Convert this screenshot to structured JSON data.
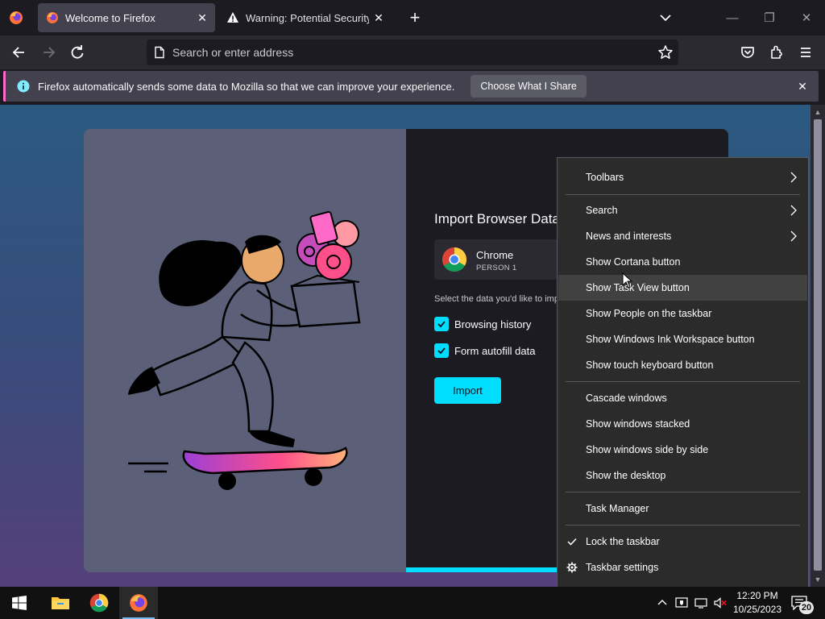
{
  "tabs": [
    {
      "label": "Welcome to Firefox",
      "active": true,
      "icon": "firefox-icon"
    },
    {
      "label": "Warning: Potential Security Risk Ahead",
      "active": false,
      "icon": "warning-icon"
    }
  ],
  "urlbar": {
    "placeholder": "Search or enter address"
  },
  "notification": {
    "text": "Firefox automatically sends some data to Mozilla so that we can improve your experience.",
    "button": "Choose What I Share"
  },
  "import_panel": {
    "title": "Import Browser Data",
    "browser_name": "Chrome",
    "browser_profile": "PERSON 1",
    "prompt": "Select the data you'd like to import",
    "options": [
      {
        "label": "Browsing history",
        "checked": true
      },
      {
        "label": "Form autofill data",
        "checked": true
      }
    ],
    "import_button": "Import",
    "progress": 0.5
  },
  "context_menu": {
    "items": [
      {
        "label": "Toolbars",
        "submenu": true
      },
      {
        "label": "Search",
        "submenu": true
      },
      {
        "label": "News and interests",
        "submenu": true
      },
      {
        "label": "Show Cortana button"
      },
      {
        "label": "Show Task View button",
        "hovered": true
      },
      {
        "label": "Show People on the taskbar"
      },
      {
        "label": "Show Windows Ink Workspace button"
      },
      {
        "label": "Show touch keyboard button"
      },
      {
        "label": "Cascade windows"
      },
      {
        "label": "Show windows stacked"
      },
      {
        "label": "Show windows side by side"
      },
      {
        "label": "Show the desktop"
      },
      {
        "label": "Task Manager"
      },
      {
        "label": "Lock the taskbar",
        "checked": true
      },
      {
        "label": "Taskbar settings",
        "icon": "gear-icon"
      }
    ]
  },
  "taskbar": {
    "time": "12:20 PM",
    "date": "10/25/2023",
    "notification_count": "20",
    "pinned": [
      "start-icon",
      "file-explorer-icon",
      "chrome-icon",
      "firefox-icon"
    ]
  },
  "colors": {
    "accent": "#00ddff",
    "notification_border": "#ff6ac8",
    "menu_bg": "#2b2b2b"
  }
}
